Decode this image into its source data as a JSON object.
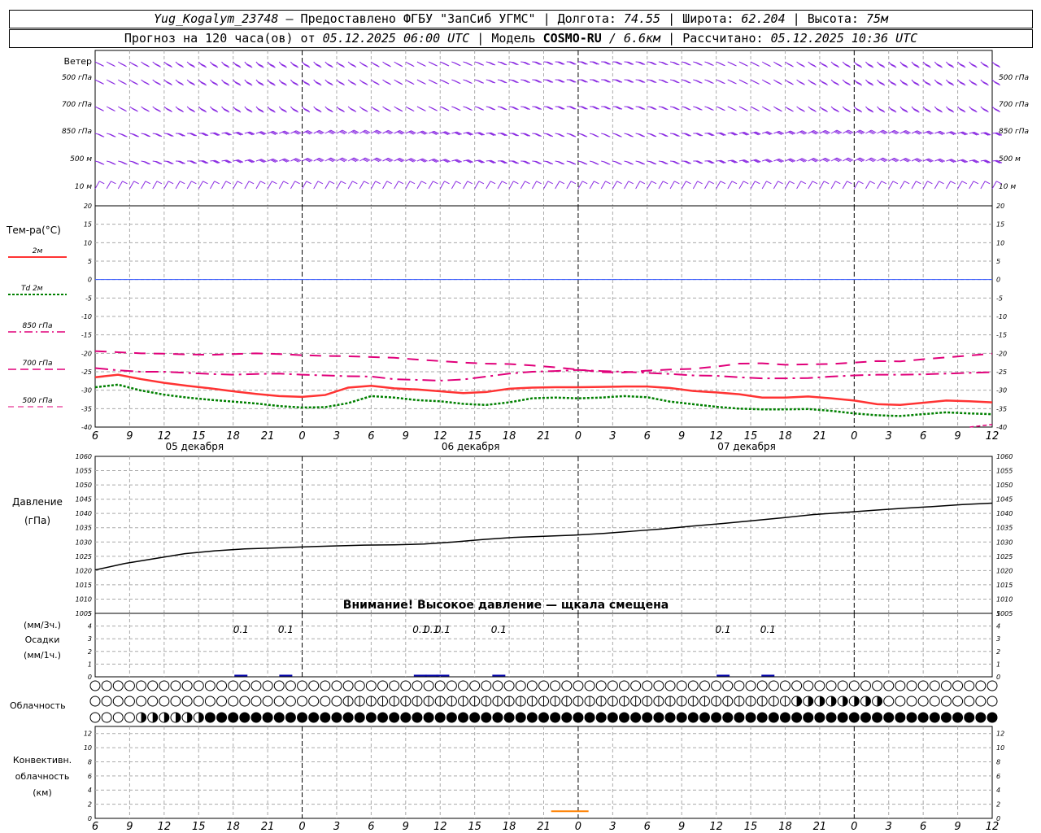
{
  "header": {
    "station": "Yug_Kogalym_23748",
    "provider": "— Предоставлено ФГБУ \"ЗапСиб УГМС\"",
    "lon_label": "Долгота:",
    "lon_value": "74.55",
    "lat_label": "Широта:",
    "lat_value": "62.204",
    "alt_label": "Высота:",
    "alt_value": "75м",
    "forecast_label": "Прогноз на 120 часа(ов) от",
    "forecast_start": "05.12.2025 06:00 UTC",
    "model_label": "Модель",
    "model_name": "COSMO-RU",
    "model_res": "/ 6.6км",
    "calc_label": "Рассчитано:",
    "calc_time": "05.12.2025 10:36 UTC"
  },
  "labels": {
    "wind": "Ветер",
    "wind_levels": [
      "500 гПа",
      "700 гПа",
      "850 гПа",
      "500 м",
      "10 м"
    ],
    "temp_title": "Тем-ра(°С)",
    "temp_legend": [
      "2м",
      "Td 2м",
      "850 гПа",
      "700 гПа",
      "500 гПа"
    ],
    "pressure_title": "Давление",
    "pressure_unit": "(гПа)",
    "pressure_warning": "Внимание! Высокое давление — щкала смещена",
    "precip_unit_3h": "(мм/3ч.)",
    "precip_title": "Осадки",
    "precip_unit_1h": "(мм/1ч.)",
    "cloud_title": "Облачность",
    "conv_title_1": "Конвективн.",
    "conv_title_2": "облачность",
    "conv_unit": "(км)",
    "day_labels": [
      "05 декабря",
      "06 декабря",
      "07 декабря"
    ]
  },
  "colors": {
    "wind": "#8a2be2",
    "t2m": "#ff3333",
    "td2m": "#008000",
    "t850": "#e0007a",
    "t700": "#e0007a",
    "t500": "#e0007a",
    "zero": "#3355ff",
    "pressure": "#000000",
    "precip": "#0000aa",
    "conv": "#ff8000"
  },
  "chart_data": [
    {
      "type": "line",
      "panel": "temperature",
      "x_hours": [
        0,
        3,
        6,
        9,
        12,
        15,
        18,
        21,
        24,
        27,
        30,
        33,
        36,
        39,
        42,
        45,
        48,
        51,
        54,
        57,
        60,
        63,
        66,
        69,
        72,
        75,
        78
      ],
      "x_tick_labels": [
        "6",
        "9",
        "12",
        "15",
        "18",
        "21",
        "0",
        "3",
        "6",
        "9",
        "12",
        "15",
        "18",
        "21",
        "0",
        "3",
        "6",
        "9",
        "12",
        "15",
        "18",
        "21",
        "0",
        "3",
        "6",
        "9",
        "12"
      ],
      "ylim": [
        -40,
        20
      ],
      "y_ticks": [
        20,
        15,
        10,
        5,
        0,
        -5,
        -10,
        -15,
        -20,
        -25,
        -30,
        -35,
        -40
      ],
      "series": [
        {
          "name": "2м",
          "key": "t2m",
          "style": "solid",
          "width": 2.5,
          "values": [
            -26.5,
            -25.8,
            -27,
            -28,
            -28.8,
            -29.5,
            -30.3,
            -31,
            -31.6,
            -31.8,
            -31.3,
            -29.3,
            -28.8,
            -29.5,
            -29.8,
            -30.3,
            -30.8,
            -30.5,
            -29.6,
            -29.3,
            -29.2,
            -29.2,
            -29.1,
            -29,
            -29,
            -29.4,
            -30.2,
            -30.6,
            -31.1,
            -32,
            -32,
            -31.7,
            -32.2,
            -32.8,
            -33.8,
            -34,
            -33.4,
            -32.8,
            -33,
            -33.3
          ]
        },
        {
          "name": "Td 2м",
          "key": "td2m",
          "style": "dotted",
          "width": 2.5,
          "values": [
            -29.2,
            -28.5,
            -30.1,
            -31.2,
            -32,
            -32.6,
            -33.1,
            -33.6,
            -34.3,
            -34.7,
            -34.6,
            -33.5,
            -31.6,
            -32,
            -32.7,
            -33,
            -33.7,
            -34,
            -33.3,
            -32.2,
            -32,
            -32.2,
            -32,
            -31.6,
            -31.9,
            -33.1,
            -33.8,
            -34.5,
            -35,
            -35.2,
            -35.2,
            -35.1,
            -35.6,
            -36.3,
            -36.8,
            -37,
            -36.5,
            -36,
            -36.3,
            -36.5
          ]
        },
        {
          "name": "850 гПа",
          "key": "t850",
          "style": "dashdot",
          "width": 2,
          "values": [
            -24,
            -24.6,
            -25,
            -25,
            -25.3,
            -25.6,
            -25.8,
            -25.6,
            -25.5,
            -25.8,
            -26,
            -26.2,
            -26.3,
            -27,
            -27.2,
            -27.4,
            -27.1,
            -26.3,
            -25.5,
            -25,
            -24.8,
            -24.5,
            -24.8,
            -25,
            -25.3,
            -25.6,
            -26,
            -26.1,
            -26.5,
            -26.8,
            -26.8,
            -26.7,
            -26.3,
            -26,
            -25.8,
            -25.8,
            -25.7,
            -25.5,
            -25.3,
            -25.1
          ]
        },
        {
          "name": "700 гПа",
          "key": "t700",
          "style": "dashed",
          "width": 2,
          "values": [
            -19.4,
            -19.7,
            -20,
            -20.1,
            -20.3,
            -20.4,
            -20.2,
            -20,
            -20.2,
            -20.5,
            -20.7,
            -20.8,
            -21,
            -21.2,
            -21.7,
            -22.1,
            -22.5,
            -22.8,
            -22.9,
            -23.3,
            -23.8,
            -24.4,
            -25.1,
            -25.2,
            -24.7,
            -24.4,
            -24.2,
            -23.6,
            -22.8,
            -22.7,
            -23.1,
            -23,
            -22.9,
            -22.5,
            -22.1,
            -22.2,
            -21.6,
            -21.1,
            -20.6,
            -20.1
          ]
        }
      ],
      "extra_segment": {
        "name": "500 гПа",
        "key": "t500",
        "hours": [
          117,
          120
        ],
        "values": [
          -40,
          -39.3
        ]
      }
    },
    {
      "type": "line",
      "panel": "pressure",
      "ylabel": "(гПа)",
      "ylim": [
        1005,
        1060
      ],
      "y_ticks": [
        1060,
        1055,
        1050,
        1045,
        1040,
        1035,
        1030,
        1025,
        1020,
        1015,
        1010,
        1005
      ],
      "values": [
        1020.2,
        1022.5,
        1024.2,
        1025.9,
        1026.9,
        1027.6,
        1027.9,
        1028.3,
        1028.6,
        1028.9,
        1029,
        1029.3,
        1030,
        1030.9,
        1031.6,
        1032,
        1032.4,
        1033,
        1033.8,
        1034.6,
        1035.6,
        1036.5,
        1037.5,
        1038.5,
        1039.6,
        1040.3,
        1041.1,
        1041.8,
        1042.4,
        1043.1,
        1043.6
      ]
    },
    {
      "type": "bar",
      "panel": "precipitation",
      "ylim": [
        0,
        5
      ],
      "y_ticks": [
        5,
        4,
        3,
        2,
        1,
        0
      ],
      "bars": [
        {
          "hour": 39,
          "value": 0.1,
          "label": "0.1"
        },
        {
          "hour": 51,
          "value": 0.1,
          "label": "0.1"
        },
        {
          "hour": 87,
          "value": 0.1,
          "label": "0.1"
        },
        {
          "hour": 90,
          "value": 0.1,
          "label": "0.1"
        },
        {
          "hour": 93,
          "value": 0.1,
          "label": "0.1"
        },
        {
          "hour": 108,
          "value": 0.1,
          "label": "0.1"
        },
        {
          "hour": 168,
          "value": 0.1,
          "label": "0.1"
        },
        {
          "hour": 180,
          "value": 0.1,
          "label": "0.1"
        }
      ]
    },
    {
      "type": "line",
      "panel": "convective_cloud",
      "ylabel": "(км)",
      "ylim": [
        0,
        13
      ],
      "y_ticks": [
        12,
        10,
        8,
        6,
        4,
        2,
        0
      ],
      "segment": {
        "hours": [
          61,
          66
        ],
        "value": 1
      }
    }
  ]
}
